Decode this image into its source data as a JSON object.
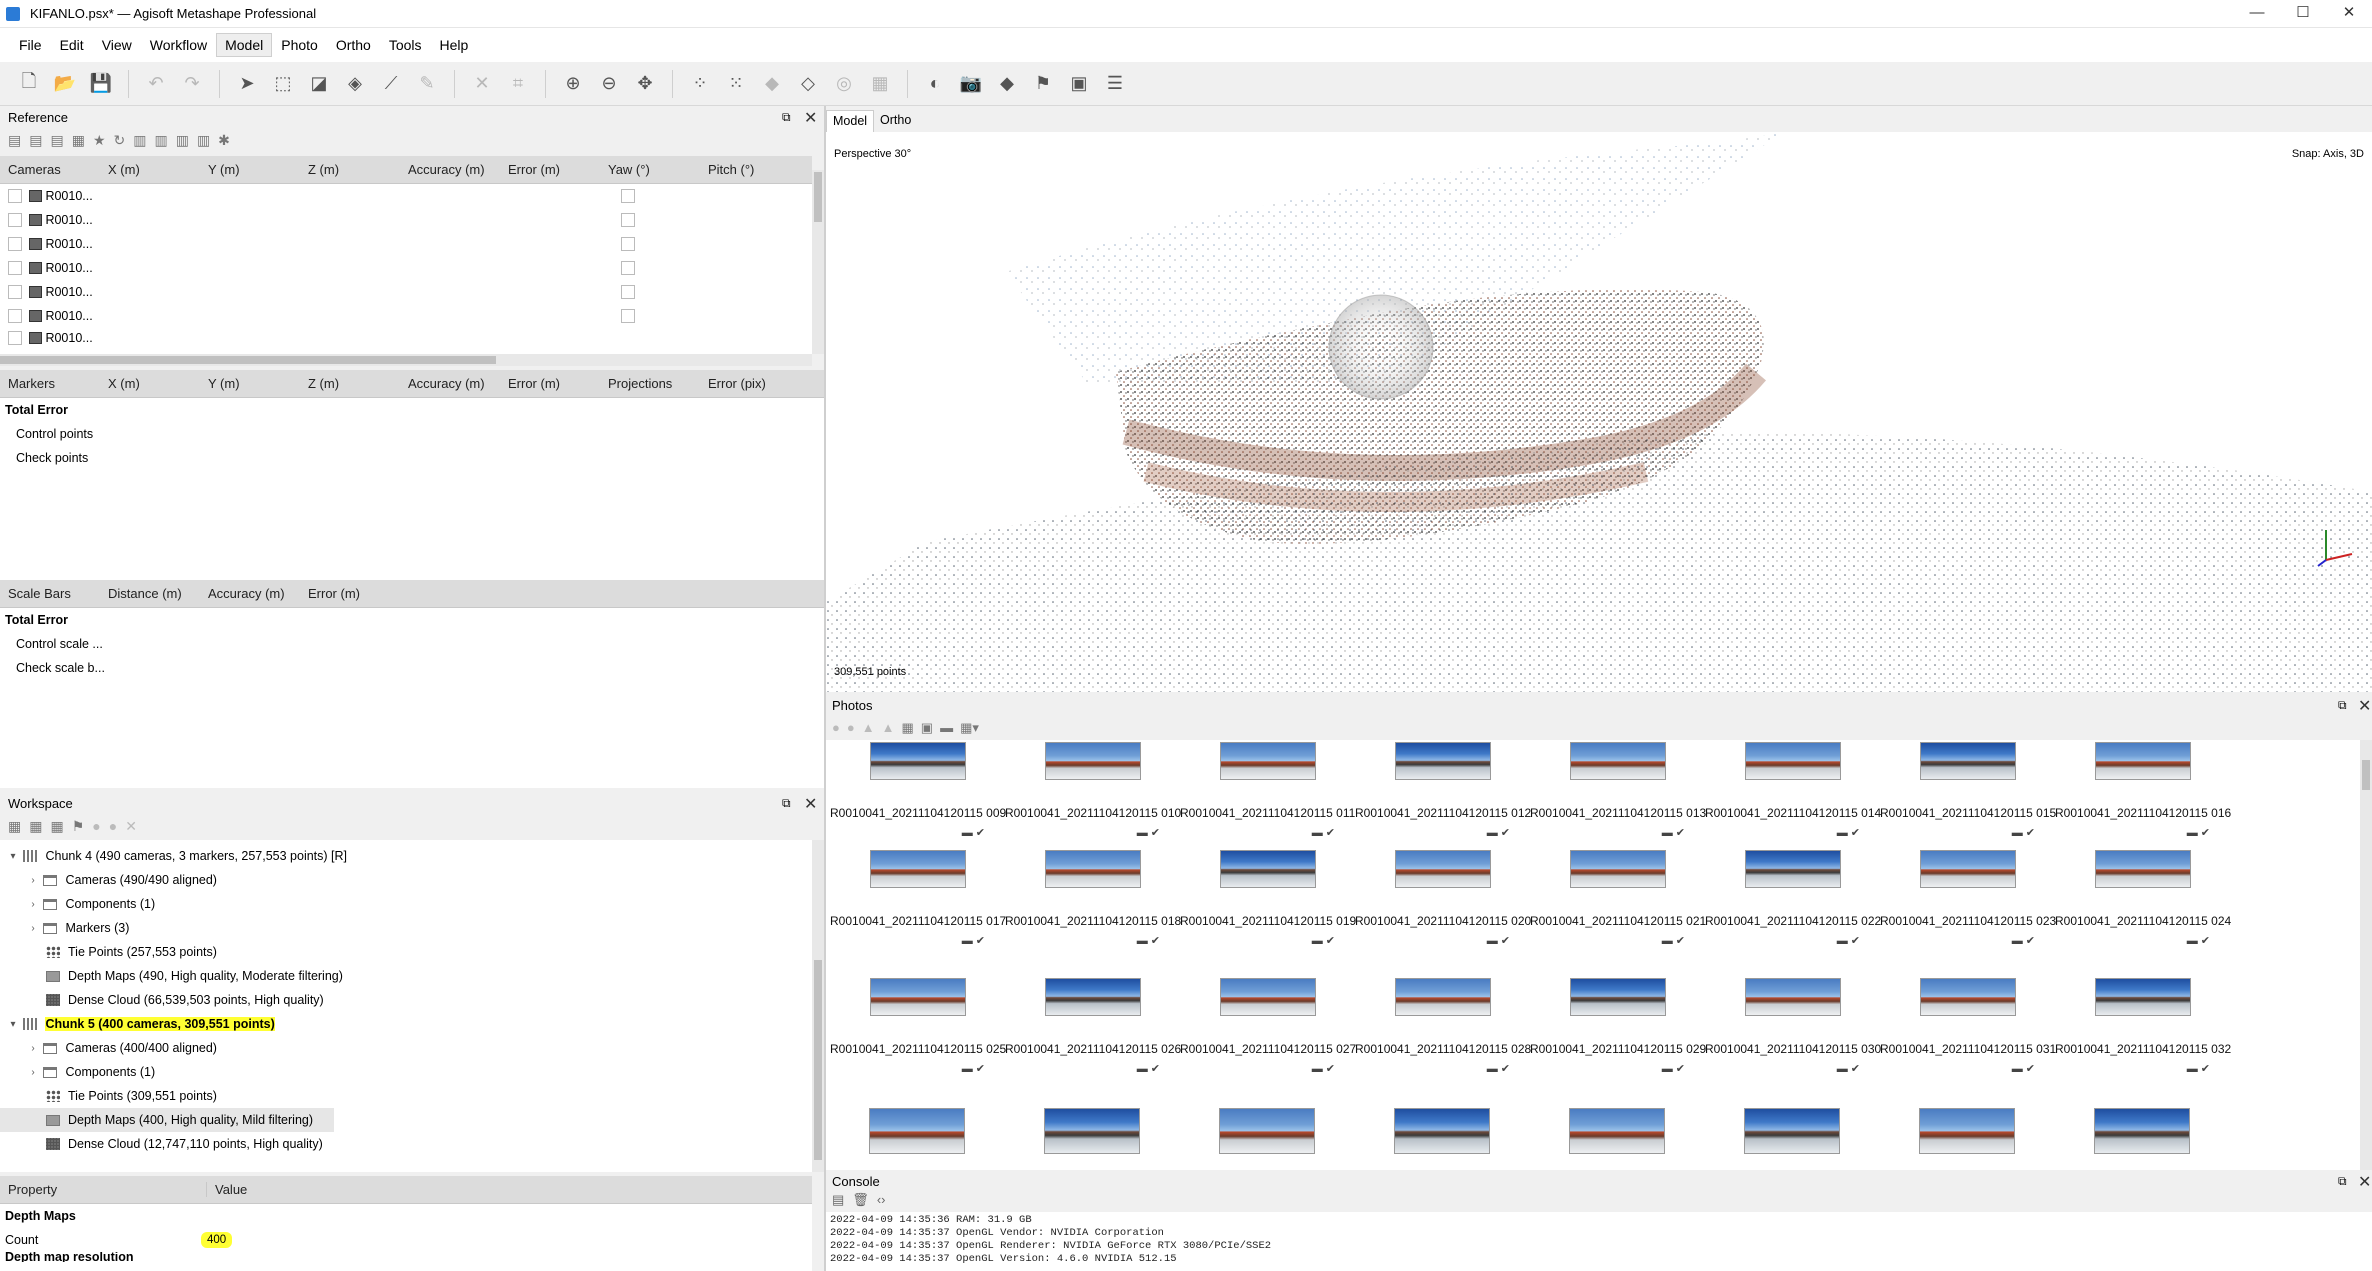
{
  "window": {
    "title": "KIFANLO.psx* — Agisoft Metashape Professional",
    "minimize": "—",
    "maximize": "☐",
    "close": "✕"
  },
  "menu": [
    "File",
    "Edit",
    "View",
    "Workflow",
    "Model",
    "Photo",
    "Ortho",
    "Tools",
    "Help"
  ],
  "menu_active": "Model",
  "reference": {
    "title": "Reference",
    "camera_columns": [
      "Cameras",
      "X (m)",
      "Y (m)",
      "Z (m)",
      "Accuracy (m)",
      "Error (m)",
      "Yaw (°)",
      "Pitch (°)"
    ],
    "camera_rows": [
      "R0010...",
      "R0010...",
      "R0010...",
      "R0010...",
      "R0010...",
      "R0010...",
      "R0010..."
    ],
    "marker_columns": [
      "Markers",
      "X (m)",
      "Y (m)",
      "Z (m)",
      "Accuracy (m)",
      "Error (m)",
      "Projections",
      "Error (pix)"
    ],
    "marker_rows": [
      "Total Error",
      "Control points",
      "Check points"
    ],
    "scalebar_columns": [
      "Scale Bars",
      "Distance (m)",
      "Accuracy (m)",
      "Error (m)"
    ],
    "scalebar_rows": [
      "Total Error",
      "Control scale ...",
      "Check scale b..."
    ]
  },
  "workspace": {
    "title": "Workspace",
    "tree": [
      {
        "label": "Chunk 4 (490 cameras, 3 markers, 257,553 points) [R]",
        "level": 0,
        "icon": "chunk",
        "arrow": "open"
      },
      {
        "label": "Cameras (490/490 aligned)",
        "level": 1,
        "icon": "folder",
        "arrow": "closed"
      },
      {
        "label": "Components (1)",
        "level": 1,
        "icon": "folder",
        "arrow": "closed"
      },
      {
        "label": "Markers (3)",
        "level": 1,
        "icon": "folder",
        "arrow": "closed"
      },
      {
        "label": "Tie Points (257,553 points)",
        "level": 1,
        "icon": "dots",
        "arrow": ""
      },
      {
        "label": "Depth Maps (490, High quality, Moderate filtering)",
        "level": 1,
        "icon": "depth",
        "arrow": ""
      },
      {
        "label": "Dense Cloud (66,539,503 points, High quality)",
        "level": 1,
        "icon": "dense",
        "arrow": ""
      },
      {
        "label": "Chunk 5 (400 cameras, 309,551 points)",
        "level": 0,
        "icon": "chunk",
        "arrow": "open",
        "highlight": true
      },
      {
        "label": "Cameras (400/400 aligned)",
        "level": 1,
        "icon": "folder",
        "arrow": "closed"
      },
      {
        "label": "Components (1)",
        "level": 1,
        "icon": "folder",
        "arrow": "closed"
      },
      {
        "label": "Tie Points (309,551 points)",
        "level": 1,
        "icon": "dots",
        "arrow": ""
      },
      {
        "label": "Depth Maps (400, High quality, Mild filtering)",
        "level": 1,
        "icon": "depth",
        "arrow": "",
        "selected": true
      },
      {
        "label": "Dense Cloud (12,747,110 points, High quality)",
        "level": 1,
        "icon": "dense",
        "arrow": ""
      }
    ]
  },
  "properties": {
    "columns": [
      "Property",
      "Value"
    ],
    "section": "Depth Maps",
    "count_label": "Count",
    "count_value": "400",
    "truncated": "Depth map resolution"
  },
  "viewport": {
    "tabs": [
      "Model",
      "Ortho"
    ],
    "active_tab": "Model",
    "perspective": "Perspective 30°",
    "snap": "Snap: Axis, 3D",
    "points": "309,551 points"
  },
  "photos": {
    "title": "Photos",
    "rows": [
      [
        "R0010041_20211104120115 009",
        "R0010041_20211104120115 010",
        "R0010041_20211104120115 011",
        "R0010041_20211104120115 012",
        "R0010041_20211104120115 013",
        "R0010041_20211104120115 014",
        "R0010041_20211104120115 015",
        "R0010041_20211104120115 016"
      ],
      [
        "R0010041_20211104120115 017",
        "R0010041_20211104120115 018",
        "R0010041_20211104120115 019",
        "R0010041_20211104120115 020",
        "R0010041_20211104120115 021",
        "R0010041_20211104120115 022",
        "R0010041_20211104120115 023",
        "R0010041_20211104120115 024"
      ],
      [
        "R0010041_20211104120115 025",
        "R0010041_20211104120115 026",
        "R0010041_20211104120115 027",
        "R0010041_20211104120115 028",
        "R0010041_20211104120115 029",
        "R0010041_20211104120115 030",
        "R0010041_20211104120115 031",
        "R0010041_20211104120115 032"
      ]
    ]
  },
  "console": {
    "title": "Console",
    "lines": [
      "2022-04-09 14:35:36 RAM: 31.9 GB",
      "2022-04-09 14:35:37 OpenGL Vendor: NVIDIA Corporation",
      "2022-04-09 14:35:37 OpenGL Renderer: NVIDIA GeForce RTX 3080/PCIe/SSE2",
      "2022-04-09 14:35:37 OpenGL Version: 4.6.0 NVIDIA 512.15"
    ]
  }
}
